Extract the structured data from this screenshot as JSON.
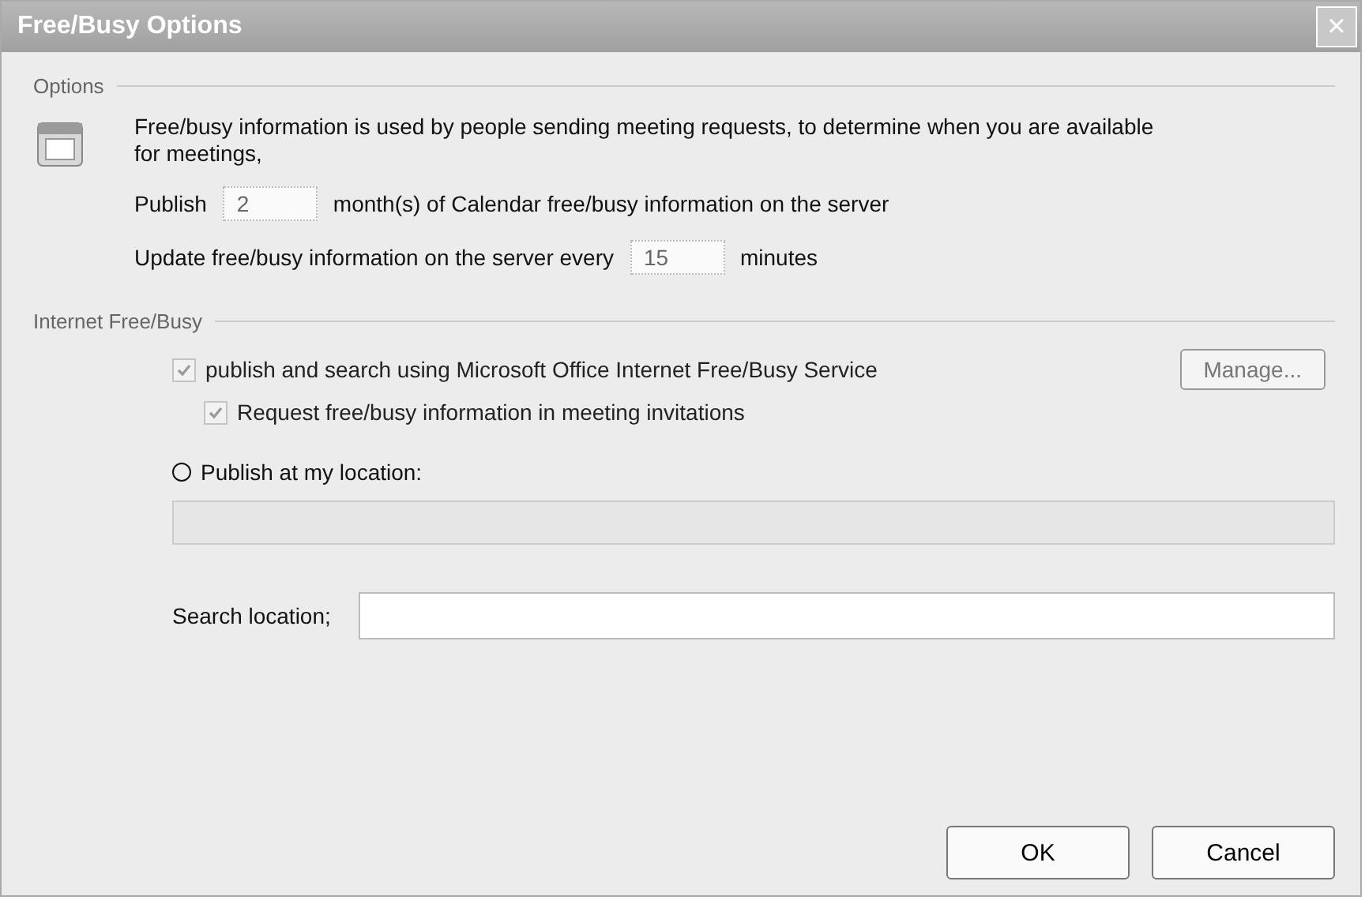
{
  "window": {
    "title": "Free/Busy Options",
    "close_glyph": "×"
  },
  "options": {
    "heading": "Options",
    "description": "Free/busy information is used by people sending meeting requests, to determine when you are available for meetings,",
    "publish": {
      "label": "Publish",
      "value": "2",
      "unit": "month(s) of Calendar free/busy information on the server"
    },
    "update": {
      "label": "Update free/busy information on the server every",
      "value": "15",
      "unit": "minutes"
    }
  },
  "internet": {
    "heading": "Internet Free/Busy",
    "checkboxes": [
      {
        "label": "publish and search using Microsoft Office Internet Free/Busy Service",
        "checked": true,
        "disabled": true,
        "children": [
          {
            "label": "Request free/busy information in meeting invitations",
            "checked": true,
            "disabled": true
          }
        ]
      }
    ],
    "manage_button": "Manage...",
    "publish_location": {
      "label": "Publish at my location:",
      "selected": false,
      "disabled": true
    },
    "search_location": {
      "label": "Search location;"
    }
  },
  "buttons": [
    "OK",
    "Cancel"
  ]
}
